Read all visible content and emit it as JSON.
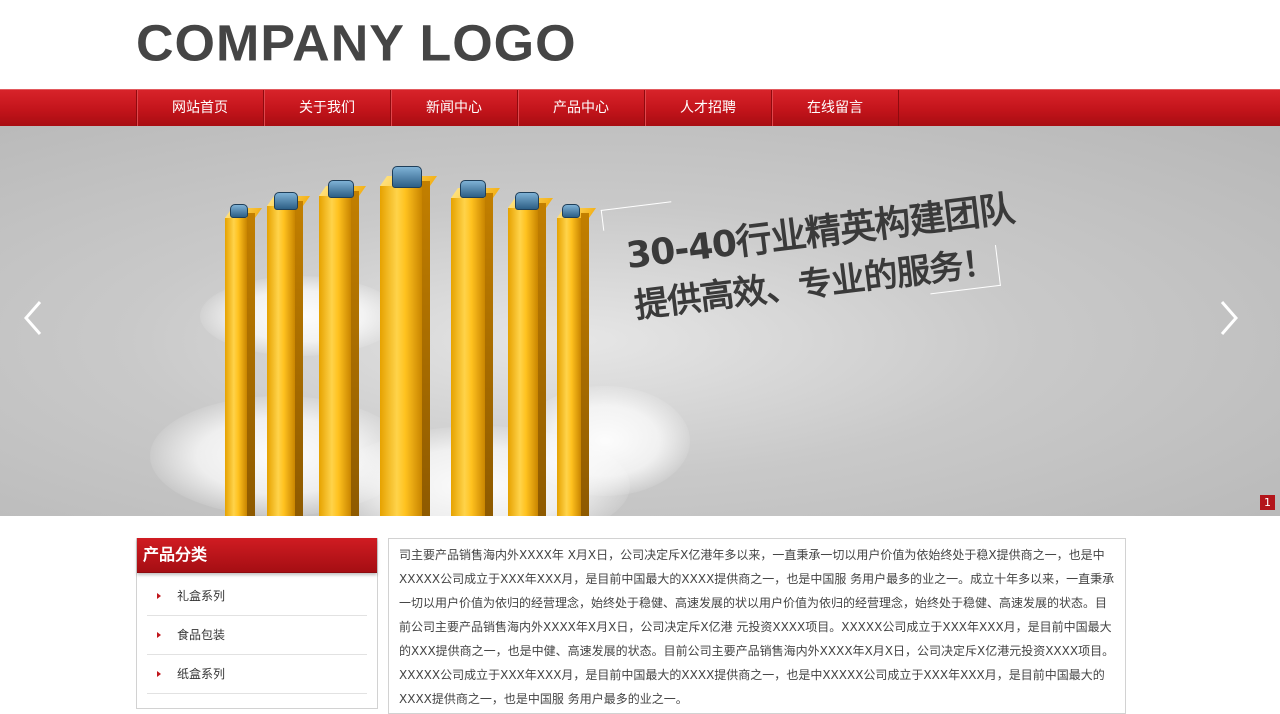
{
  "header": {
    "logo_text": "COMPANY LOGO"
  },
  "nav": {
    "items": [
      {
        "label": "网站首页"
      },
      {
        "label": "关于我们"
      },
      {
        "label": "新闻中心"
      },
      {
        "label": "产品中心"
      },
      {
        "label": "人才招聘"
      },
      {
        "label": "在线留言"
      }
    ]
  },
  "banner": {
    "slogan_line1": "30-40行业精英构建团队",
    "slogan_line2": "提供高效、专业的服务！",
    "slide_number": "1",
    "prev_icon": "chevron-left-icon",
    "next_icon": "chevron-right-icon",
    "colors": {
      "bar": "#ffc21f",
      "nav_red": "#c3141b"
    }
  },
  "sidebar": {
    "title": "产品分类",
    "items": [
      {
        "label": "礼盒系列"
      },
      {
        "label": "食品包装"
      },
      {
        "label": "纸盒系列"
      }
    ]
  },
  "article": {
    "text": "司主要产品销售海内外XXXX年 X月X日，公司决定斥X亿港年多以来，一直秉承一切以用户价值为依始终处于稳X提供商之一，也是中XXXXX公司成立于XXX年XXX月，是目前中国最大的XXXX提供商之一，也是中国服 务用户最多的业之一。成立十年多以来，一直秉承一切以用户价值为依归的经营理念，始终处于稳健、高速发展的状以用户价值为依归的经营理念，始终处于稳健、高速发展的状态。目前公司主要产品销售海内外XXXX年X月X日，公司决定斥X亿港 元投资XXXX项目。XXXXX公司成立于XXX年XXX月，是目前中国最大的XXX提供商之一，也是中健、高速发展的状态。目前公司主要产品销售海内外XXXX年X月X日，公司决定斥X亿港元投资XXXX项目。XXXXX公司成立于XXX年XXX月，是目前中国最大的XXXX提供商之一，也是中XXXXX公司成立于XXX年XXX月，是目前中国最大的XXXX提供商之一，也是中国服 务用户最多的业之一。"
  }
}
